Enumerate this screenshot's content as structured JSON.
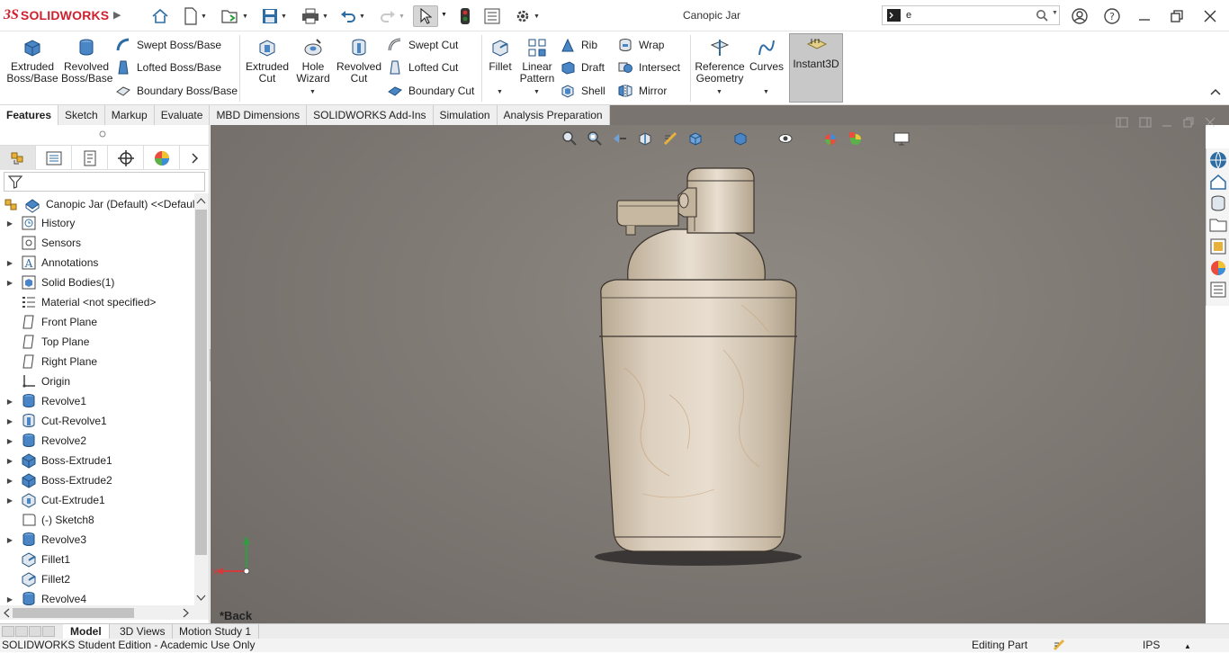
{
  "app": {
    "brand_prefix": "3S",
    "brand": "SOLIDWORKS",
    "document_title": "Canopic Jar"
  },
  "search": {
    "value": "e"
  },
  "ribbon": {
    "extruded_boss": "Extruded Boss/Base",
    "revolved_boss": "Revolved Boss/Base",
    "swept_boss": "Swept Boss/Base",
    "lofted_boss": "Lofted Boss/Base",
    "boundary_boss": "Boundary Boss/Base",
    "extruded_cut": "Extruded Cut",
    "hole_wizard": "Hole Wizard",
    "revolved_cut": "Revolved Cut",
    "swept_cut": "Swept Cut",
    "lofted_cut": "Lofted Cut",
    "boundary_cut": "Boundary Cut",
    "fillet": "Fillet",
    "linear_pattern": "Linear Pattern",
    "rib": "Rib",
    "draft": "Draft",
    "shell": "Shell",
    "wrap": "Wrap",
    "intersect": "Intersect",
    "mirror": "Mirror",
    "reference_geometry": "Reference Geometry",
    "curves": "Curves",
    "instant3d": "Instant3D"
  },
  "command_tabs": [
    "Features",
    "Sketch",
    "Markup",
    "Evaluate",
    "MBD Dimensions",
    "SOLIDWORKS Add-Ins",
    "Simulation",
    "Analysis Preparation"
  ],
  "tree": {
    "root": "Canopic Jar (Default) <<Default",
    "items": [
      {
        "label": "History",
        "icon": "history-icon",
        "expandable": true
      },
      {
        "label": "Sensors",
        "icon": "sensors-icon",
        "expandable": false
      },
      {
        "label": "Annotations",
        "icon": "annotations-icon",
        "expandable": true
      },
      {
        "label": "Solid Bodies(1)",
        "icon": "solid-bodies-icon",
        "expandable": true
      },
      {
        "label": "Material <not specified>",
        "icon": "material-icon",
        "expandable": false
      },
      {
        "label": "Front Plane",
        "icon": "plane-icon",
        "expandable": false
      },
      {
        "label": "Top Plane",
        "icon": "plane-icon",
        "expandable": false
      },
      {
        "label": "Right Plane",
        "icon": "plane-icon",
        "expandable": false
      },
      {
        "label": "Origin",
        "icon": "origin-icon",
        "expandable": false
      },
      {
        "label": "Revolve1",
        "icon": "revolve-icon",
        "expandable": true
      },
      {
        "label": "Cut-Revolve1",
        "icon": "cut-revolve-icon",
        "expandable": true
      },
      {
        "label": "Revolve2",
        "icon": "revolve-icon",
        "expandable": true
      },
      {
        "label": "Boss-Extrude1",
        "icon": "boss-extrude-icon",
        "expandable": true
      },
      {
        "label": "Boss-Extrude2",
        "icon": "boss-extrude-icon",
        "expandable": true
      },
      {
        "label": "Cut-Extrude1",
        "icon": "cut-extrude-icon",
        "expandable": true
      },
      {
        "label": "(-) Sketch8",
        "icon": "sketch-icon",
        "expandable": false
      },
      {
        "label": "Revolve3",
        "icon": "revolve-icon",
        "expandable": true
      },
      {
        "label": "Fillet1",
        "icon": "fillet-icon",
        "expandable": false
      },
      {
        "label": "Fillet2",
        "icon": "fillet-icon",
        "expandable": false
      },
      {
        "label": "Revolve4",
        "icon": "revolve-icon",
        "expandable": true
      }
    ]
  },
  "viewport": {
    "view_label": "*Back",
    "triad_y": "Y",
    "triad_x": "X"
  },
  "bottom_tabs": [
    "Model",
    "3D Views",
    "Motion Study 1"
  ],
  "status": {
    "left": "SOLIDWORKS Student Edition - Academic Use Only",
    "mode": "Editing Part",
    "units": "IPS"
  },
  "colors": {
    "accent_red": "#d0202e",
    "icon_blue": "#2e6da4",
    "viewport_bg": "#807a75",
    "marble": "#d9cbb9"
  }
}
